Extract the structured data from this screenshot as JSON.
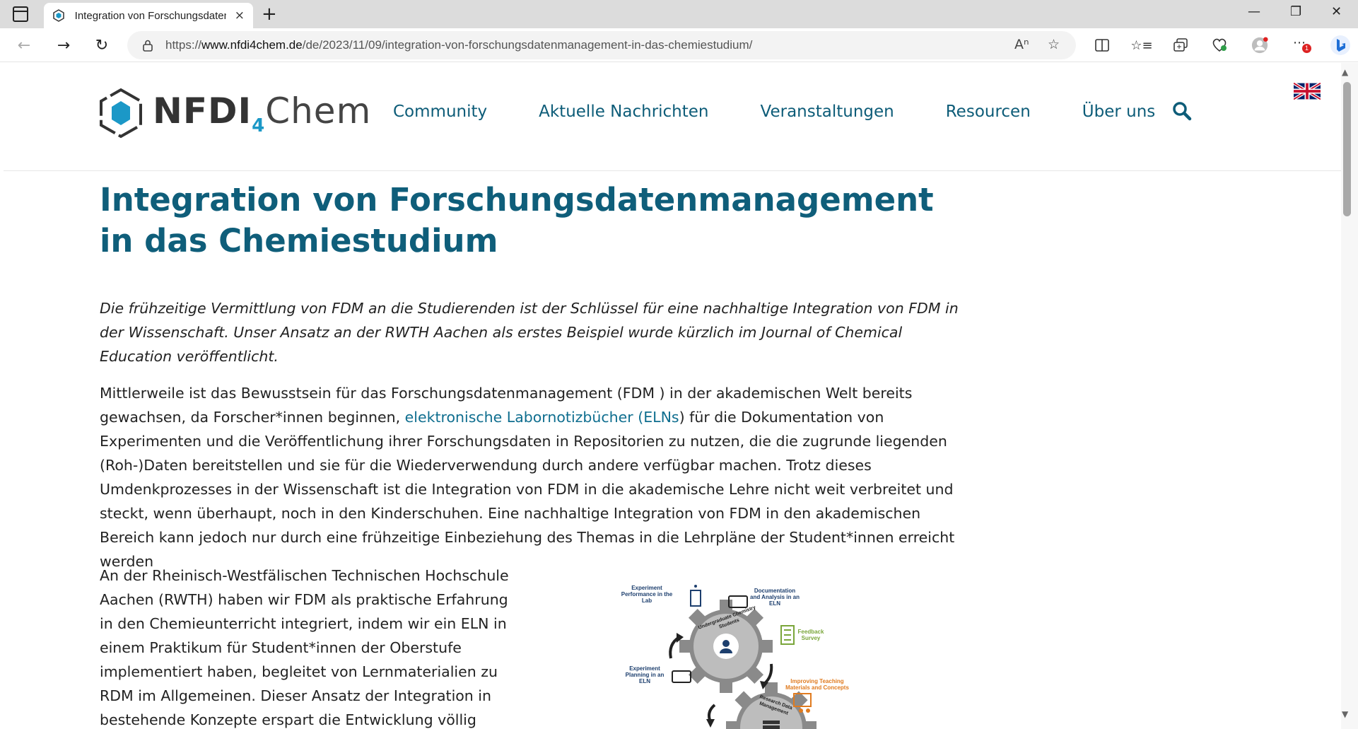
{
  "browser": {
    "tab_title": "Integration von Forschungsdaten",
    "tab_close": "×",
    "new_tab": "+",
    "url_scheme_prefix": "https://",
    "url_host": "www.nfdi4chem.de",
    "url_path": "/de/2023/11/09/integration-von-forschungsdatenmanagement-in-das-chemiestudium/",
    "notification_count": "1"
  },
  "site": {
    "logo_part1": "NFDI",
    "logo_sub": "4",
    "logo_part2": "Chem",
    "nav": [
      {
        "label": "Community"
      },
      {
        "label": "Aktuelle Nachrichten"
      },
      {
        "label": "Veranstaltungen"
      },
      {
        "label": "Resourcen"
      },
      {
        "label": "Über uns"
      }
    ]
  },
  "article": {
    "title": "Integration von Forschungsdatenmanagement in das Chemiestudium",
    "lead": "Die frühzeitige Vermittlung von FDM an die Studierenden ist der Schlüssel für eine nachhaltige Integration von FDM in der Wissenschaft. Unser Ansatz an der RWTH Aachen als erstes Beispiel wurde kürzlich im Journal of Chemical Education veröffentlicht.",
    "para1_before": "Mittlerweile ist das Bewusstsein für das Forschungsdatenmanagement (FDM ) in der akademischen Welt bereits gewachsen, da Forscher*innen beginnen, ",
    "para1_link": "elektronische Labornotizbücher (ELNs",
    "para1_after": ") für die Dokumentation von Experimenten und die Veröffentlichung ihrer Forschungsdaten in Repositorien zu nutzen, die die zugrunde liegenden (Roh-)Daten bereitstellen und sie für die Wiederverwendung durch andere verfügbar machen. Trotz dieses Umdenkprozesses in der Wissenschaft ist die Integration von FDM in die akademische Lehre nicht weit verbreitet und steckt, wenn überhaupt, noch in den Kinderschuhen. Eine nachhaltige Integration von FDM in den akademischen Bereich kann jedoch nur durch eine frühzeitige Einbeziehung des Themas in die Lehrpläne der Student*innen erreicht werden",
    "para2": "An der Rheinisch-Westfälischen Technischen Hochschule Aachen (RWTH) haben wir FDM als praktische Erfahrung in den Chemieunterricht integriert, indem wir ein ELN in einem Praktikum für Student*innen der Oberstufe implementiert haben, begleitet von Lernmaterialien zu RDM im Allgemeinen. Dieser Ansatz der Integration in bestehende Konzepte erspart die Entwicklung völlig"
  },
  "figure": {
    "label_experiment_performance": "Experiment Performance in the Lab",
    "label_documentation": "Documentation and Analysis in an ELN",
    "label_feedback": "Feedback Survey",
    "label_experiment_planning": "Experiment Planning in an ELN",
    "label_improving": "Improving Teaching Materials and Concepts",
    "gear_top_text": "Undergraduate Chemistry Students",
    "gear_bottom_text": "Research Data Management"
  },
  "colors": {
    "brand": "#0f5e7a",
    "link": "#0f6e8f",
    "logo_accent": "#1b98c7",
    "feedback_green": "#7aa63a",
    "improving_orange": "#e07b1f"
  }
}
